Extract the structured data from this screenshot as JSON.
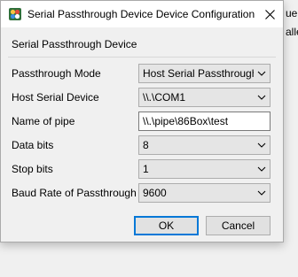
{
  "background": {
    "snippet_1": "ue",
    "snippet_2": "alle"
  },
  "dialog": {
    "title": "Serial Passthrough Device Device Configuration",
    "group_title": "Serial Passthrough Device",
    "fields": [
      {
        "label": "Passthrough Mode",
        "value": "Host Serial Passthrough",
        "kind": "dropdown"
      },
      {
        "label": "Host Serial Device",
        "value": "\\\\.\\COM1",
        "kind": "dropdown"
      },
      {
        "label": "Name of pipe",
        "value": "\\\\.\\pipe\\86Box\\test",
        "kind": "text"
      },
      {
        "label": "Data bits",
        "value": "8",
        "kind": "dropdown"
      },
      {
        "label": "Stop bits",
        "value": "1",
        "kind": "dropdown"
      },
      {
        "label": "Baud Rate of Passthrough",
        "value": "9600",
        "kind": "dropdown"
      }
    ],
    "ok_label": "OK",
    "cancel_label": "Cancel"
  },
  "icons": {
    "app": "86box-app-icon",
    "close": "close-icon",
    "dropdown": "chevron-down-icon"
  },
  "colors": {
    "accent": "#0078d7",
    "window_bg": "#f0f0f0",
    "titlebar_bg": "#ffffff"
  }
}
